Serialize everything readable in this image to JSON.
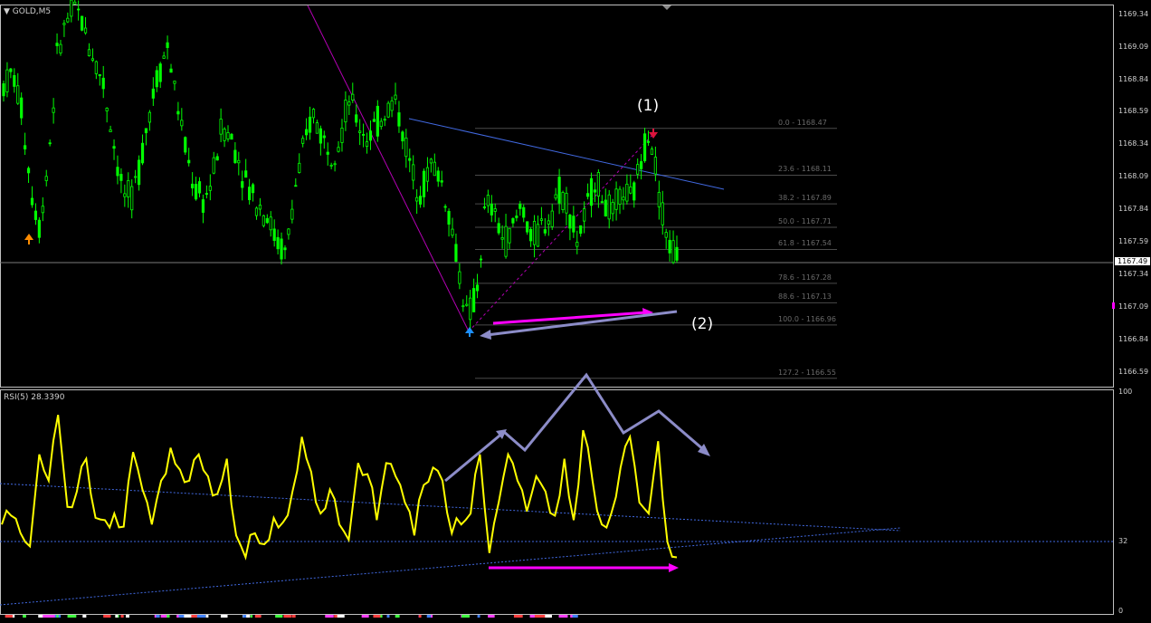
{
  "symbol": "GOLD,M5",
  "indicator_label": "RSI(5) 28.3390",
  "current_price": "1167.49",
  "price_axis": [
    "1169.34",
    "1169.09",
    "1168.84",
    "1168.59",
    "1168.34",
    "1168.09",
    "1167.84",
    "1167.59",
    "1167.34",
    "1167.09",
    "1166.84",
    "1166.59"
  ],
  "rsi_axis": [
    "100",
    "32",
    "0"
  ],
  "fib_levels": [
    {
      "label": "0.0 - 1168.47",
      "value": 1168.47
    },
    {
      "label": "23.6 - 1168.11",
      "value": 1168.11
    },
    {
      "label": "38.2 - 1167.89",
      "value": 1167.89
    },
    {
      "label": "50.0 - 1167.71",
      "value": 1167.71
    },
    {
      "label": "61.8 - 1167.54",
      "value": 1167.54
    },
    {
      "label": "78.6 - 1167.28",
      "value": 1167.28
    },
    {
      "label": "88.6 - 1167.13",
      "value": 1167.13
    },
    {
      "label": "100.0 - 1166.96",
      "value": 1166.96
    },
    {
      "label": "127.2 - 1166.55",
      "value": 1166.55
    }
  ],
  "annotations": {
    "wave1": "(1)",
    "wave2": "(2)"
  },
  "colors": {
    "candles": "#00ff00",
    "rsi": "#ffff00",
    "fib": "#5a5a5a",
    "trend": "#4169e1",
    "magenta": "#ff00ff",
    "lavender": "#8c8cc8",
    "fib_diag": "#b400b4",
    "grid": "#c0c0c0"
  },
  "chart_data": {
    "type": "line",
    "ylim": [
      1166.5,
      1169.4
    ],
    "rsi_ylim": [
      0,
      100
    ],
    "series": [
      {
        "values": [
          1168.8,
          1168.9,
          1168.6,
          1168.0,
          1167.7,
          1168.3,
          1169.1,
          1169.3,
          1169.4,
          1169.2,
          1169.0,
          1168.8,
          1168.4,
          1168.0,
          1167.9,
          1168.2,
          1168.6,
          1168.9,
          1169.1,
          1168.7,
          1168.3,
          1168.0,
          1167.9,
          1168.1,
          1168.5,
          1168.4,
          1168.2,
          1168.0,
          1167.9,
          1167.8,
          1167.6,
          1167.5,
          1168.0,
          1168.3,
          1168.6,
          1168.4,
          1168.3,
          1168.4,
          1168.7,
          1168.5,
          1168.4,
          1168.5,
          1168.6,
          1168.7,
          1168.4,
          1168.1,
          1168.0,
          1168.2,
          1168.1,
          1167.8,
          1167.4,
          1167.0,
          1167.2,
          1167.9,
          1167.8,
          1167.6,
          1167.7,
          1167.9,
          1167.6,
          1167.7,
          1167.8,
          1168.0,
          1167.9,
          1167.6,
          1167.8,
          1168.1,
          1167.9,
          1167.8,
          1168.0,
          1167.9,
          1168.2,
          1168.5,
          1168.0,
          1167.6,
          1167.5
        ]
      },
      {
        "values": [
          40,
          44,
          36,
          30,
          72,
          60,
          90,
          48,
          55,
          70,
          43,
          42,
          45,
          39,
          73,
          56,
          40,
          60,
          75,
          65,
          60,
          72,
          62,
          54,
          70,
          35,
          25,
          36,
          31,
          43,
          41,
          55,
          80,
          64,
          45,
          56,
          40,
          33,
          68,
          63,
          42,
          68,
          62,
          50,
          35,
          58,
          66,
          60,
          36,
          40,
          45,
          72,
          27,
          50,
          72,
          60,
          46,
          62,
          55,
          44,
          70,
          42,
          83,
          60,
          40,
          45,
          66,
          80,
          50,
          45,
          78,
          32,
          25
        ]
      }
    ]
  }
}
